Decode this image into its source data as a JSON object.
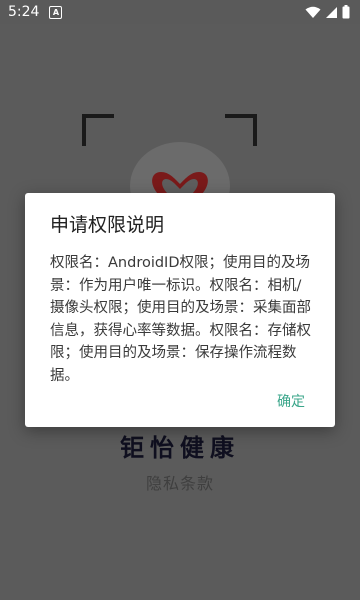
{
  "status_bar": {
    "time": "5:24",
    "notification_icon": "a-notification-icon",
    "icons": [
      "wifi-icon",
      "cellular-signal-icon",
      "battery-icon"
    ]
  },
  "background": {
    "app_name": "钜怡健康",
    "privacy_link": "隐私条款"
  },
  "dialog": {
    "title": "申请权限说明",
    "message": "权限名：AndroidID权限；使用目的及场景：作为用户唯一标识。权限名：相机/摄像头权限；使用目的及场景：采集面部信息，获得心率等数据。权限名：存储权限；使用目的及场景：保存操作流程数据。",
    "confirm_label": "确定"
  },
  "colors": {
    "accent": "#3aa68a",
    "overlay": "#5b5b5b",
    "logo_red": "#7a1a1a"
  }
}
